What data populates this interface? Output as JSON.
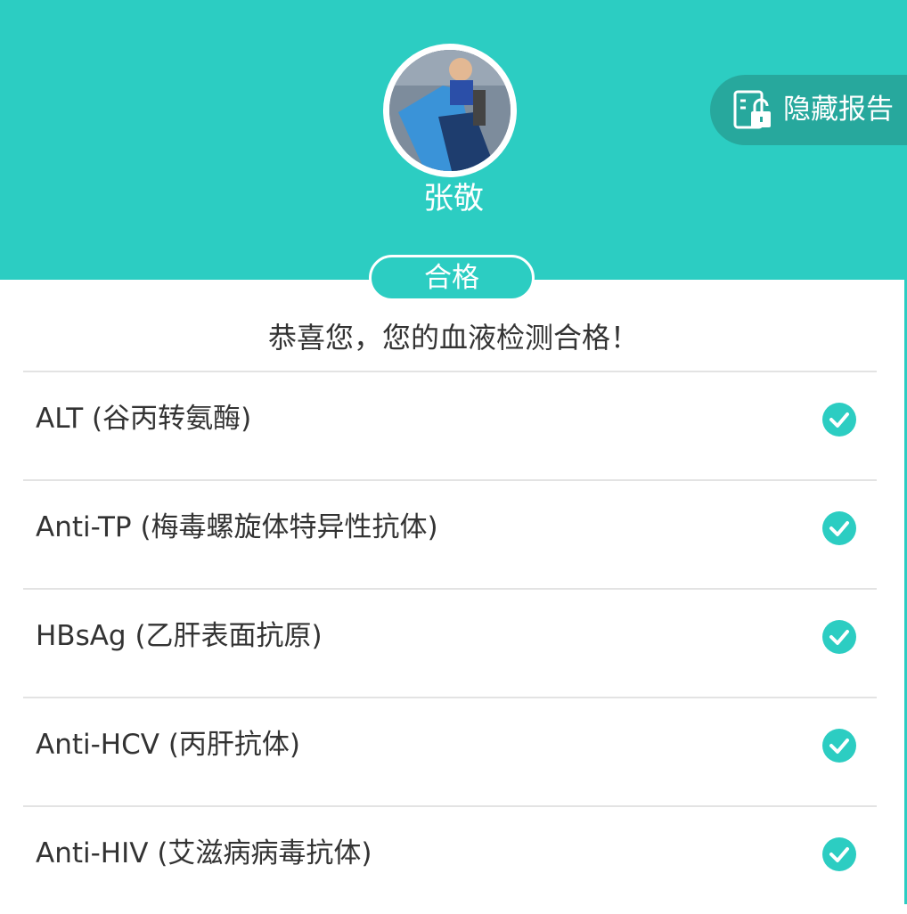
{
  "header": {
    "username": "张敬",
    "hide_report_label": "隐藏报告",
    "background_color": "#2ccdc2",
    "button_color": "#27a89d",
    "hide_report_icon": "report-lock-icon",
    "avatar_icon": "avatar-photo"
  },
  "result": {
    "status": "合格",
    "message": "恭喜您，您的血液检测合格！"
  },
  "tests": [
    {
      "label": "ALT (谷丙转氨酶)",
      "icon": "check-circle-icon"
    },
    {
      "label": "Anti-TP (梅毒螺旋体特异性抗体)",
      "icon": "check-circle-icon"
    },
    {
      "label": "HBsAg (乙肝表面抗原)",
      "icon": "check-circle-icon"
    },
    {
      "label": "Anti-HCV (丙肝抗体)",
      "icon": "check-circle-icon"
    },
    {
      "label": "Anti-HIV (艾滋病病毒抗体)",
      "icon": "check-circle-icon"
    }
  ],
  "accent_color": "#2ccdc2"
}
